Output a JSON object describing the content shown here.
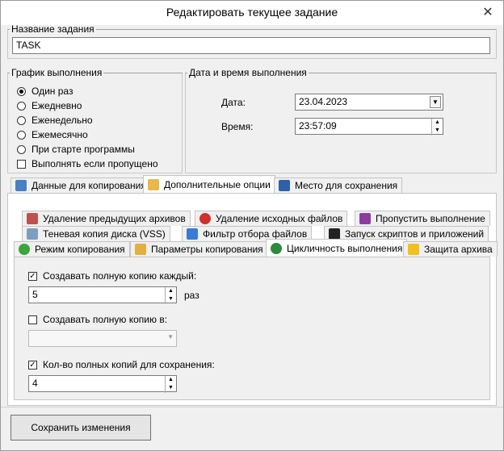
{
  "window": {
    "title": "Редактировать текущее задание",
    "close_symbol": "✕"
  },
  "task_name": {
    "legend": "Название задания",
    "value": "TASK"
  },
  "schedule": {
    "legend": "График выполнения",
    "options": [
      "Один раз",
      "Ежедневно",
      "Еженедельно",
      "Ежемесячно",
      "При старте программы"
    ],
    "selected": "Один раз",
    "run_if_missed": "Выполнять если пропущено"
  },
  "datetime": {
    "legend": "Дата и время выполнения",
    "date_label": "Дата:",
    "date_value": "23.04.2023",
    "time_label": "Время:",
    "time_value": "23:57:09"
  },
  "main_tabs": [
    "Данные для копирования",
    "Дополнительные опции",
    "Место для сохранения"
  ],
  "sub_tabs_row1": [
    "Удаление предыдущих архивов",
    "Удаление исходных файлов",
    "Пропустить выполнение"
  ],
  "sub_tabs_row2": [
    "Теневая копия диска (VSS)",
    "Фильтр отбора файлов",
    "Запуск скриптов и приложений"
  ],
  "sub_tabs_row3": [
    "Режим копирования",
    "Параметры копирования",
    "Цикличность выполнения",
    "Защита архива"
  ],
  "cyclic": {
    "full_every_label": "Создавать полную копию каждый:",
    "full_every_value": "5",
    "full_every_unit": "раз",
    "full_in_label": "Создавать полную копию в:",
    "full_in_value": "",
    "keep_count_label": "Кол-во полных копий для сохранения:",
    "keep_count_value": "4"
  },
  "save_button": "Сохранить изменения",
  "icons": {
    "arrow_down": "▼",
    "spin_up": "▲",
    "spin_down": "▼",
    "check": "✓"
  },
  "colors": {
    "window_bg": "#f0f0f0",
    "border": "#c4c4c4"
  }
}
